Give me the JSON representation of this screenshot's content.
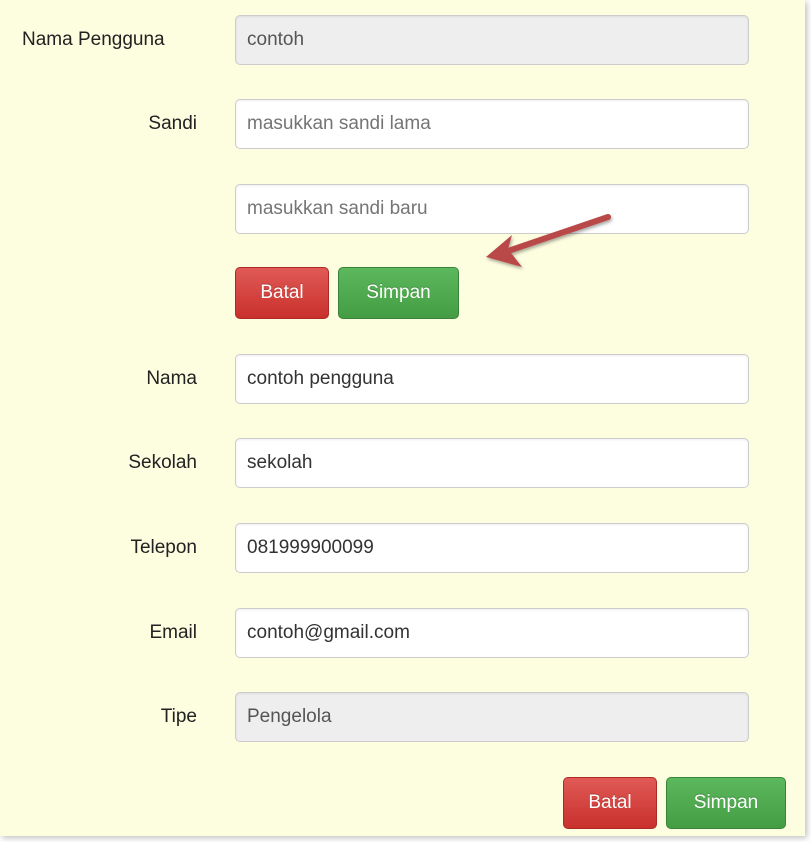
{
  "form": {
    "username": {
      "label": "Nama Pengguna",
      "value": "contoh"
    },
    "password": {
      "label": "Sandi",
      "old_placeholder": "masukkan sandi lama",
      "new_placeholder": "masukkan sandi baru",
      "cancel_label": "Batal",
      "save_label": "Simpan"
    },
    "name": {
      "label": "Nama",
      "value": "contoh pengguna"
    },
    "school": {
      "label": "Sekolah",
      "value": "sekolah"
    },
    "phone": {
      "label": "Telepon",
      "value": "081999900099"
    },
    "email": {
      "label": "Email",
      "value": "contoh@gmail.com"
    },
    "type": {
      "label": "Tipe",
      "value": "Pengelola"
    }
  },
  "footer": {
    "cancel_label": "Batal",
    "save_label": "Simpan"
  },
  "colors": {
    "panel_background": "#fdfde0",
    "danger": "#d9534f",
    "success": "#5cb85c",
    "annotation_arrow": "#b94a48"
  },
  "icons": {
    "annotation": "arrow-pointing-left-icon"
  }
}
